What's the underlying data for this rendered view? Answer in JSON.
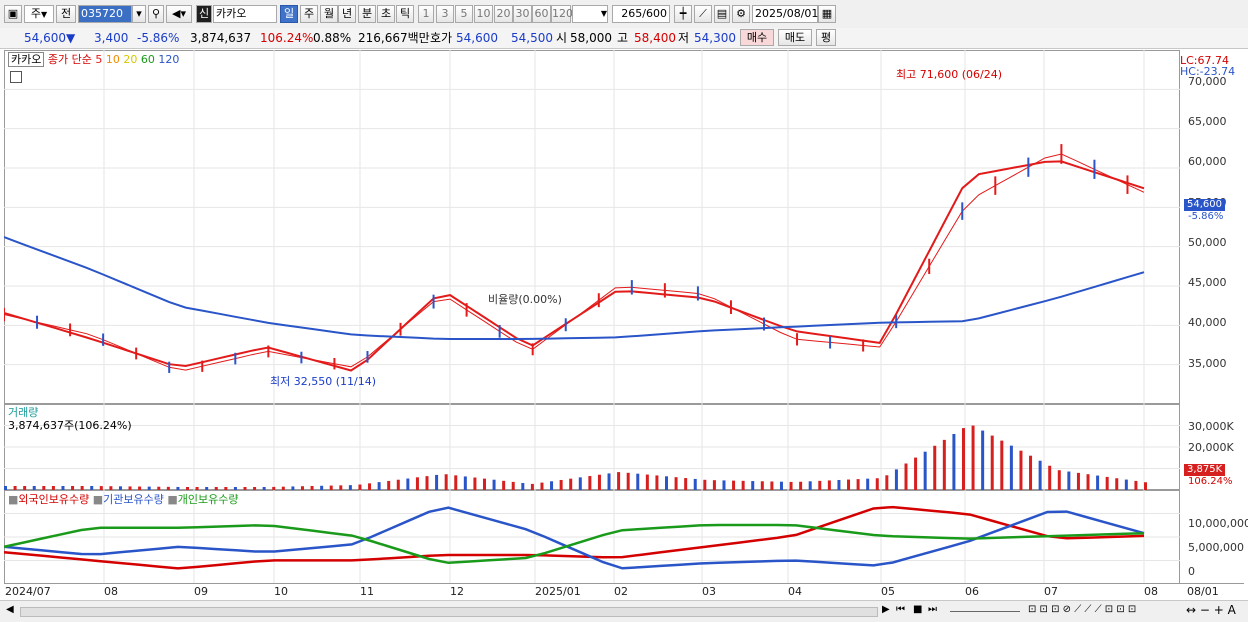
{
  "toolbar": {
    "type_select": "주",
    "prev_label": "전",
    "code": "035720",
    "sin_label": "신",
    "name": "카카오",
    "tabs": [
      "일",
      "주",
      "월",
      "년",
      "분",
      "초",
      "틱"
    ],
    "active_tab": "일",
    "periods": [
      "1",
      "3",
      "5",
      "10",
      "20",
      "30",
      "60",
      "120"
    ],
    "count": "265",
    "count_total": "/600",
    "date": "2025/08/01"
  },
  "priceline": {
    "price": "54,600",
    "arrow": "▼",
    "change": "3,400",
    "change_pct": "-5.86%",
    "volume": "3,874,637",
    "vol_pct": "106.24%",
    "turnover_pct": "0.88%",
    "amount": "216,667백만",
    "quote_label": "호가",
    "ask": "54,600",
    "bid": "54,500",
    "open_label": "시",
    "open": "58,000",
    "high_label": "고",
    "high": "58,400",
    "low_label": "저",
    "low": "54,300",
    "buy_label": "매수",
    "sell_label": "매도",
    "eval_label": "평"
  },
  "price_panel": {
    "name_tag": "카카오",
    "legend_prefix": "종가 단순",
    "ma": [
      {
        "period": "5",
        "color": "#e31a1a"
      },
      {
        "period": "10",
        "color": "#f08c00"
      },
      {
        "period": "20",
        "color": "#e8e800"
      },
      {
        "period": "60",
        "color": "#1a9a1a"
      },
      {
        "period": "120",
        "color": "#2a55c8"
      }
    ],
    "high_note": "최고 71,600 (06/24)",
    "low_note": "최저 32,550 (11/14)",
    "ratio_note": "비율량(0.00%)",
    "lc": "LC:67.74",
    "hc": "HC:-23.74",
    "y_ticks": [
      "70,000",
      "65,000",
      "60,000",
      "55,000",
      "50,000",
      "45,000",
      "40,000",
      "35,000"
    ],
    "last_price": "54,600",
    "last_pct": "-5.86%"
  },
  "volume_panel": {
    "title": "거래량",
    "value": "3,874,637주(106.24%)",
    "y_ticks": [
      "30,000K",
      "20,000K",
      "10,000K"
    ],
    "last": "3,875K",
    "last_pct": "106.24%"
  },
  "holding_panel": {
    "legend": [
      {
        "label": "외국인보유수량",
        "color": "#d40000"
      },
      {
        "label": "기관보유수량",
        "color": "#2a55c8"
      },
      {
        "label": "개인보유수량",
        "color": "#1a9a1a"
      }
    ],
    "y_ticks": [
      "10,000,000",
      "5,000,000",
      "0"
    ]
  },
  "x_axis": [
    "2024/07",
    "08",
    "09",
    "10",
    "11",
    "12",
    "2025/01",
    "02",
    "03",
    "04",
    "05",
    "06",
    "07",
    "08"
  ],
  "x_axis_right": "08/01",
  "chart_data": [
    {
      "type": "line",
      "title": "카카오",
      "x": [
        "2024/07",
        "08",
        "09",
        "10",
        "11",
        "12",
        "2025/01",
        "02",
        "03",
        "04",
        "05",
        "06",
        "07",
        "08"
      ],
      "series": [
        {
          "name": "종가",
          "values": [
            41000,
            38500,
            34000,
            36500,
            34500,
            43500,
            36500,
            44500,
            43500,
            38000,
            37000,
            55000,
            61000,
            56000
          ]
        },
        {
          "name": "5",
          "values": [
            41200,
            38000,
            34500,
            37000,
            34000,
            44000,
            37000,
            44000,
            43000,
            39000,
            37500,
            58000,
            60000,
            56500
          ]
        },
        {
          "name": "120",
          "values": [
            50500,
            46500,
            42000,
            40000,
            38500,
            38000,
            38000,
            38200,
            39000,
            39500,
            40000,
            40200,
            43000,
            46200
          ]
        }
      ],
      "annotations": {
        "high": "최고 71,600 (06/24)",
        "low": "최저 32,550 (11/14)"
      },
      "ylim": [
        31000,
        72000
      ]
    },
    {
      "type": "bar",
      "title": "거래량",
      "categories": [
        "2024/07",
        "08",
        "09",
        "10",
        "11",
        "12",
        "2025/01",
        "02",
        "03",
        "04",
        "05",
        "06",
        "07",
        "08"
      ],
      "values": [
        2000,
        2000,
        1500,
        1500,
        2500,
        8000,
        3000,
        9000,
        5000,
        4000,
        6000,
        33000,
        10000,
        3875
      ],
      "ylim": [
        0,
        35000
      ]
    },
    {
      "type": "line",
      "x": [
        "2024/07",
        "08",
        "09",
        "10",
        "11",
        "12",
        "2025/01",
        "02",
        "03",
        "04",
        "05",
        "06",
        "07",
        "08"
      ],
      "series": [
        {
          "name": "외국인보유수량",
          "values": [
            4000000,
            2500000,
            1000000,
            2500000,
            2500000,
            3500000,
            3500000,
            3000000,
            5000000,
            7000000,
            12500000,
            11000000,
            6500000,
            7000000
          ]
        },
        {
          "name": "기관보유수량",
          "values": [
            5000000,
            3500000,
            5000000,
            4000000,
            5500000,
            12500000,
            8000000,
            1000000,
            2000000,
            2500000,
            1500000,
            6000000,
            12000000,
            7500000
          ]
        },
        {
          "name": "개인보유수량",
          "values": [
            5000000,
            8500000,
            8500000,
            9000000,
            7000000,
            2000000,
            3000000,
            8000000,
            9000000,
            9000000,
            7000000,
            6500000,
            7000000,
            7500000
          ]
        }
      ],
      "ylim": [
        0,
        12500000
      ]
    }
  ]
}
